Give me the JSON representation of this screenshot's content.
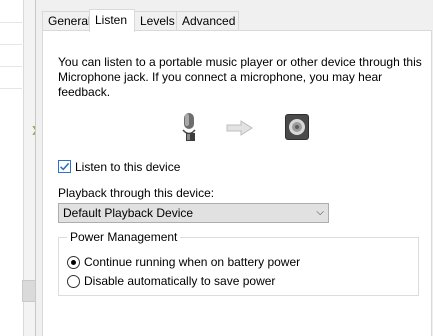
{
  "tabs": [
    "General",
    "Listen",
    "Levels",
    "Advanced"
  ],
  "active_tab": "Listen",
  "description": "You can listen to a portable music player or other device through this Microphone jack.  If you connect a microphone, you may hear feedback.",
  "icons": {
    "source": "microphone-icon",
    "arrow": "right-arrow-icon",
    "target": "speaker-icon"
  },
  "listen": {
    "label": "Listen to this device",
    "checked": true
  },
  "playback": {
    "label": "Playback through this device:",
    "selected": "Default Playback Device"
  },
  "power": {
    "title": "Power Management",
    "options": [
      {
        "label": "Continue running when on battery power",
        "selected": true
      },
      {
        "label": "Disable automatically to save power",
        "selected": false
      }
    ]
  },
  "colors": {
    "check_accent": "#2d70c8",
    "pane_background": "#ffffff",
    "dialog_background": "#f0f0f0"
  }
}
